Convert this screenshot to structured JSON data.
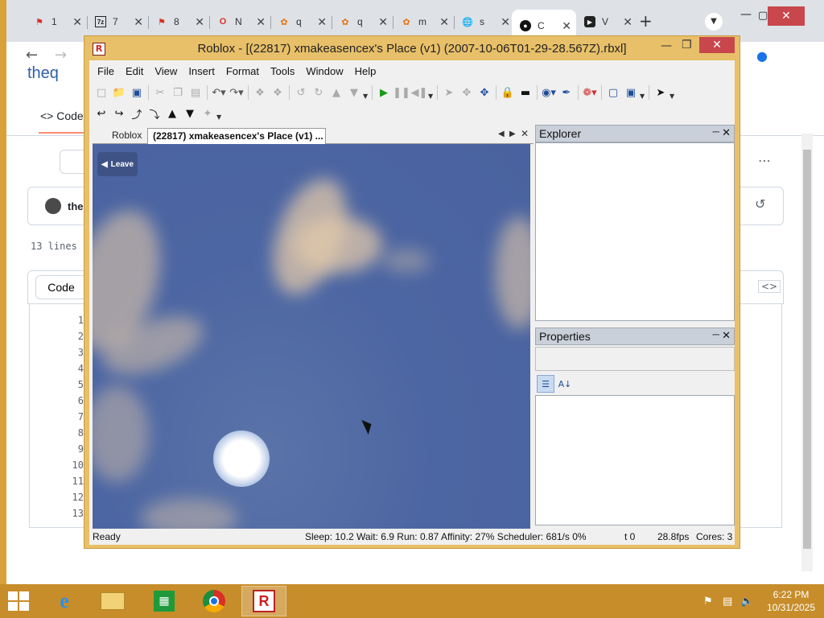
{
  "browser": {
    "tabs": [
      {
        "label": "1",
        "icon": "bookmark-icon",
        "color": "#d93025"
      },
      {
        "label": "7",
        "icon": "7zip-icon",
        "color": "#222222"
      },
      {
        "label": "8",
        "icon": "bookmark-icon",
        "color": "#d93025"
      },
      {
        "label": "N",
        "icon": "opera-icon",
        "color": "#d93025"
      },
      {
        "label": "q",
        "icon": "gear-flower-icon",
        "color": "#e8710a"
      },
      {
        "label": "q",
        "icon": "gear-flower-icon",
        "color": "#e8710a"
      },
      {
        "label": "m",
        "icon": "gear-flower-icon",
        "color": "#e8710a"
      },
      {
        "label": "s",
        "icon": "globe-icon",
        "color": "#5f6368"
      },
      {
        "label": "C",
        "icon": "github-icon",
        "color": "#111111"
      },
      {
        "label": "V",
        "icon": "video-icon",
        "color": "#111111"
      }
    ],
    "new_tab": "+",
    "page": {
      "logo_text": "theq",
      "code_tab": "Code",
      "user": "theq",
      "line_count": "13 lines (",
      "code_button": "Code",
      "line_numbers": [
        "1",
        "2",
        "3",
        "4",
        "5",
        "6",
        "7",
        "8",
        "9",
        "10",
        "11",
        "12",
        "13"
      ]
    }
  },
  "studio": {
    "title": "Roblox - [(22817) xmakeasencex's Place (v1) (2007-10-06T01-29-28.567Z).rbxl]",
    "menu": [
      "File",
      "Edit",
      "View",
      "Insert",
      "Format",
      "Tools",
      "Window",
      "Help"
    ],
    "doc_tabs": {
      "first": "Roblox",
      "active": "(22817) xmakeasencex's Place (v1) ..."
    },
    "leave_label": "Leave",
    "explorer_title": "Explorer",
    "properties_title": "Properties",
    "status": {
      "ready": "Ready",
      "stats": "Sleep: 10.2 Wait: 6.9 Run: 0.87 Affinity: 27% Scheduler: 681/s 0%",
      "t": "t 0",
      "fps": "28.8fps",
      "cores": "Cores: 3"
    }
  },
  "taskbar": {
    "time": "6:22 PM",
    "date": "10/31/2025",
    "apps": [
      "internet-explorer-icon",
      "file-explorer-icon",
      "store-icon",
      "chrome-icon",
      "roblox-icon"
    ]
  },
  "colors": {
    "accent_desktop": "#d9a13a",
    "studio_frame": "#e8c069",
    "close_red": "#c7474c"
  }
}
